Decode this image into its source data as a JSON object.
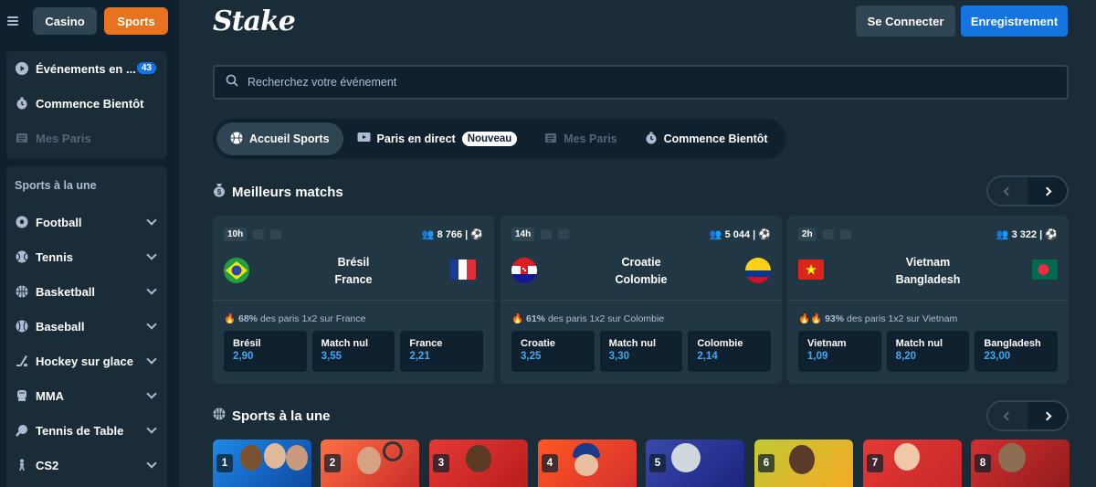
{
  "sidebar": {
    "casino_label": "Casino",
    "sports_label": "Sports",
    "top_items": [
      {
        "label": "Événements en ...",
        "badge": "43",
        "icon": "play-icon"
      },
      {
        "label": "Commence Bientôt",
        "icon": "stopwatch-icon"
      },
      {
        "label": "Mes Paris",
        "icon": "ticket-icon"
      }
    ],
    "section_heading": "Sports à la une",
    "sports": [
      {
        "label": "Football",
        "icon": "football-icon"
      },
      {
        "label": "Tennis",
        "icon": "tennis-icon"
      },
      {
        "label": "Basketball",
        "icon": "basketball-icon"
      },
      {
        "label": "Baseball",
        "icon": "baseball-icon"
      },
      {
        "label": "Hockey sur glace",
        "icon": "hockey-icon"
      },
      {
        "label": "MMA",
        "icon": "glove-icon"
      },
      {
        "label": "Tennis de Table",
        "icon": "table-tennis-icon"
      },
      {
        "label": "CS2",
        "icon": "soldier-icon"
      }
    ]
  },
  "header": {
    "logo": "Stake",
    "login_label": "Se Connecter",
    "register_label": "Enregistrement"
  },
  "search": {
    "placeholder": "Recherchez votre événement"
  },
  "tabs": [
    {
      "label": "Accueil Sports",
      "icon": "ball-icon",
      "active": true
    },
    {
      "label": "Paris en direct",
      "icon": "tv-icon",
      "badge": "Nouveau"
    },
    {
      "label": "Mes Paris",
      "icon": "ticket-icon"
    },
    {
      "label": "Commence Bientôt",
      "icon": "stopwatch-icon"
    }
  ],
  "top_matches": {
    "title": "Meilleurs matchs",
    "cards": [
      {
        "time": "10h",
        "bets": "8 766",
        "home": "Brésil",
        "away": "France",
        "hint_pct": "68%",
        "hint_text": "des paris 1x2 sur France",
        "odds": [
          {
            "label": "Brésil",
            "value": "2,90"
          },
          {
            "label": "Match nul",
            "value": "3,55"
          },
          {
            "label": "France",
            "value": "2,21"
          }
        ]
      },
      {
        "time": "14h",
        "bets": "5 044",
        "home": "Croatie",
        "away": "Colombie",
        "hint_pct": "61%",
        "hint_text": "des paris 1x2 sur Colombie",
        "odds": [
          {
            "label": "Croatie",
            "value": "3,25"
          },
          {
            "label": "Match nul",
            "value": "3,30"
          },
          {
            "label": "Colombie",
            "value": "2,14"
          }
        ]
      },
      {
        "time": "2h",
        "bets": "3 322",
        "home": "Vietnam",
        "away": "Bangladesh",
        "hint_pct": "93%",
        "hint_text": "des paris 1x2 sur Vietnam",
        "odds": [
          {
            "label": "Vietnam",
            "value": "1,09"
          },
          {
            "label": "Match nul",
            "value": "8,20"
          },
          {
            "label": "Bangladesh",
            "value": "23,00"
          }
        ]
      }
    ]
  },
  "featured": {
    "title": "Sports à la une",
    "numbers": [
      "1",
      "2",
      "3",
      "4",
      "5",
      "6",
      "7",
      "8"
    ]
  },
  "colors": {
    "bg": "#1a2c38",
    "sidebar": "#0f212e",
    "card": "#213743",
    "accent_blue": "#1475e1",
    "accent_orange": "#e8731f",
    "odds_value": "#3fa9f5"
  }
}
